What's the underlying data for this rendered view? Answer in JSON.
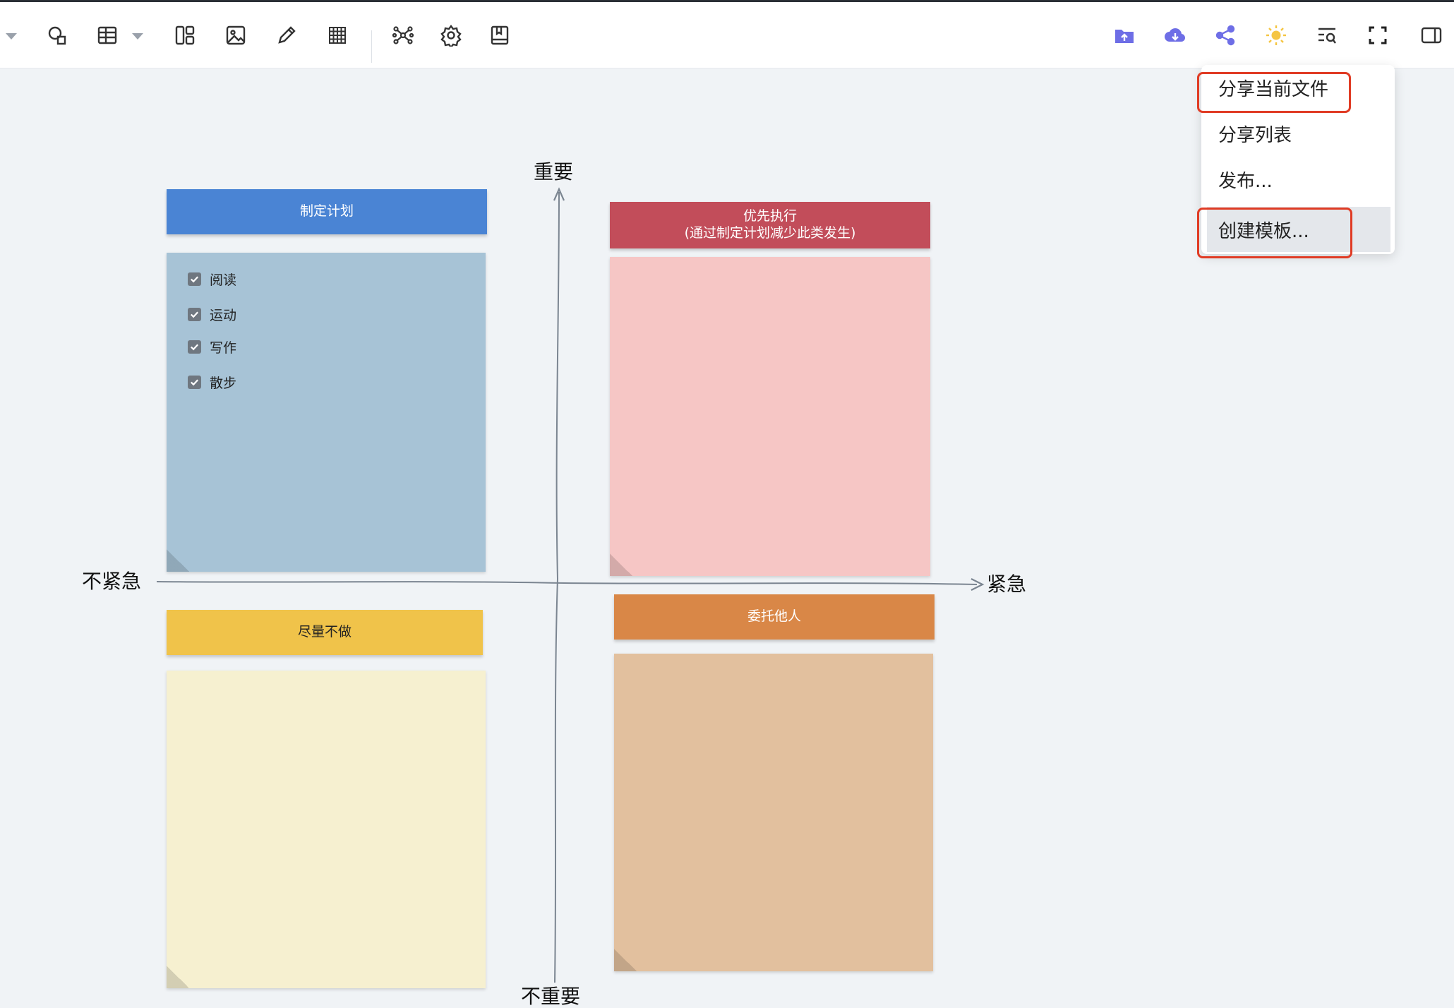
{
  "toolbar": {
    "left_icons": [
      "chevron-down-icon",
      "shape-icon",
      "table-icon",
      "chevron-down-icon",
      "layout-icon",
      "image-icon",
      "pencil-icon",
      "grid-icon",
      "mindmap-icon",
      "gear-icon",
      "book-icon"
    ],
    "right_icons": [
      "upload-folder-icon",
      "cloud-download-icon",
      "share-icon",
      "sun-icon",
      "search-outline-icon",
      "fullscreen-icon",
      "sidebar-toggle-icon"
    ],
    "accent": "#6e6ee6"
  },
  "share_menu": {
    "items": [
      "分享当前文件",
      "分享列表",
      "发布...",
      "创建模板..."
    ],
    "highlighted": [
      "分享当前文件",
      "创建模板..."
    ],
    "hovered": "创建模板..."
  },
  "matrix": {
    "axis": {
      "top": "重要",
      "bottom": "不重要",
      "left": "不紧急",
      "right": "紧急"
    },
    "quadrants": [
      {
        "title_lines": [
          "制定计划"
        ],
        "header_color": "#4a84d4",
        "body_color": "#a7c3d6",
        "checklist": [
          "阅读",
          "运动",
          "写作",
          "散步"
        ]
      },
      {
        "title_lines": [
          "优先执行",
          "(通过制定计划减少此类发生)"
        ],
        "header_color": "#c24d5a",
        "body_color": "#f6c6c5",
        "checklist": []
      },
      {
        "title_lines": [
          "尽量不做"
        ],
        "header_color": "#f0c34a",
        "body_color": "#f6f0d0",
        "checklist": []
      },
      {
        "title_lines": [
          "委托他人"
        ],
        "header_color": "#d98747",
        "body_color": "#e2c09e",
        "checklist": []
      }
    ]
  }
}
